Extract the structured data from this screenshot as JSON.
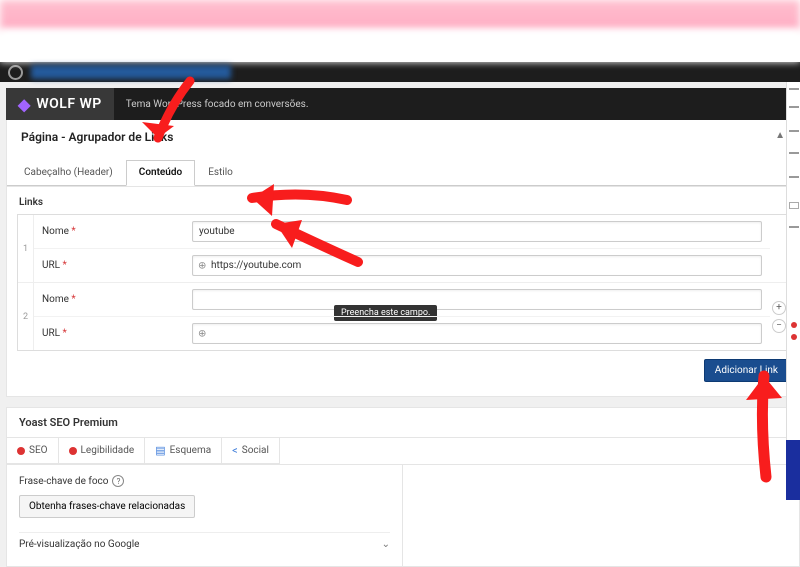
{
  "wolf": {
    "brand": "WOLF WP",
    "tagline": "Tema WordPress focado em conversões."
  },
  "page": {
    "title": "Página - Agrupador de Links",
    "tabs": {
      "header": "Cabeçalho (Header)",
      "content": "Conteúdo",
      "style": "Estilo"
    }
  },
  "links": {
    "section_label": "Links",
    "labels": {
      "name": "Nome",
      "url": "URL"
    },
    "rows": [
      {
        "name": "youtube",
        "url": "https://youtube.com"
      },
      {
        "name": "",
        "url": ""
      }
    ],
    "tooltip": "Preencha este campo.",
    "add_button": "Adicionar Link"
  },
  "yoast": {
    "panel_title": "Yoast SEO Premium",
    "tabs": {
      "seo": "SEO",
      "readability": "Legibilidade",
      "schema": "Esquema",
      "social": "Social"
    },
    "focus_label": "Frase-chave de foco",
    "related_btn": "Obtenha frases-chave relacionadas",
    "google_preview": "Pré-visualização no Google"
  }
}
